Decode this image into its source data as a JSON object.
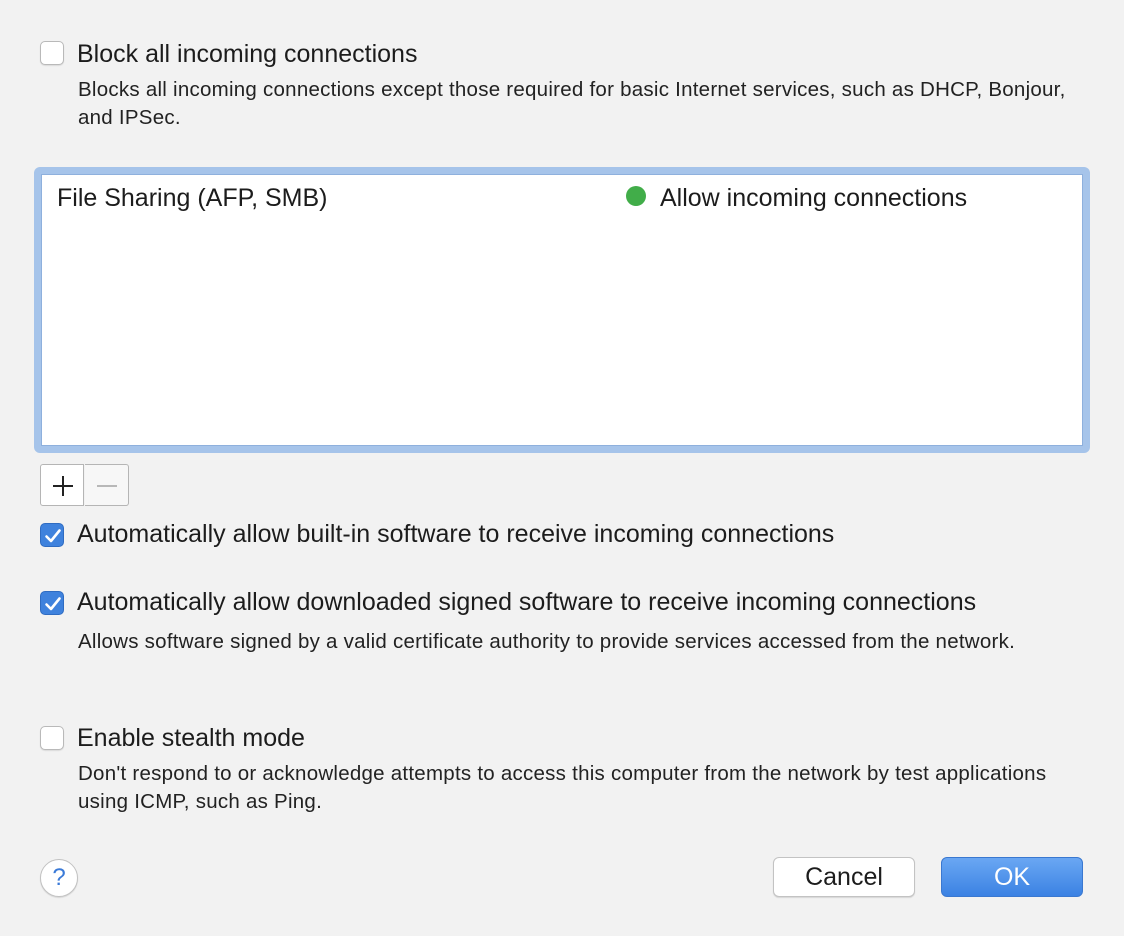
{
  "block_all": {
    "label": "Block all incoming connections",
    "checked": false,
    "description": "Blocks all incoming connections except those required for basic Internet services,  such as DHCP, Bonjour, and IPSec."
  },
  "services": [
    {
      "name": "File Sharing (AFP, SMB)",
      "status": "Allow incoming connections",
      "status_color": "#41ad49"
    }
  ],
  "list_controls": {
    "add_icon": "plus-icon",
    "remove_icon": "minus-icon"
  },
  "auto_builtin": {
    "label": "Automatically allow built-in software to receive incoming connections",
    "checked": true
  },
  "auto_signed": {
    "label": "Automatically allow downloaded signed software to receive incoming connections",
    "checked": true,
    "description": "Allows software signed by a valid certificate authority to provide services accessed from the network."
  },
  "stealth": {
    "label": "Enable stealth mode",
    "checked": false,
    "description": "Don't respond to or acknowledge attempts to access this computer from the network by test applications using ICMP, such as Ping."
  },
  "help": {
    "label": "?"
  },
  "buttons": {
    "cancel": "Cancel",
    "ok": "OK"
  },
  "colors": {
    "accent": "#3f82dd",
    "background": "#f2f2f2",
    "status_green": "#41ad49"
  }
}
